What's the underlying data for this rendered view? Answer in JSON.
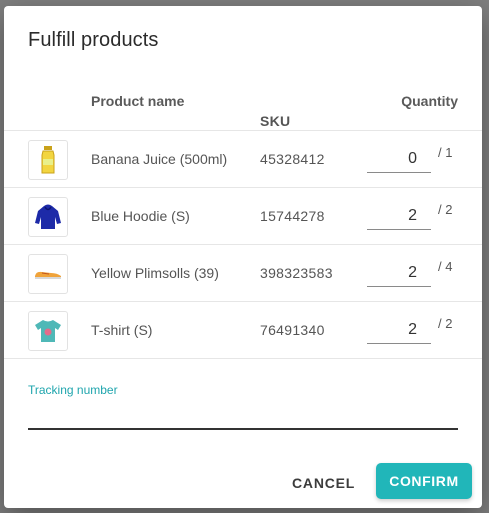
{
  "dialog": {
    "title": "Fulfill products",
    "columns": {
      "product_name": "Product name",
      "sku": "SKU",
      "quantity": "Quantity"
    },
    "rows": [
      {
        "icon": "juice-bottle-icon",
        "name": "Banana Juice (500ml)",
        "sku": "45328412",
        "quantity": "0",
        "total": "/ 1"
      },
      {
        "icon": "hoodie-icon",
        "name": "Blue Hoodie (S)",
        "sku": "15744278",
        "quantity": "2",
        "total": "/ 2"
      },
      {
        "icon": "plimsoll-shoe-icon",
        "name": "Yellow Plimsolls (39)",
        "sku": "398323583",
        "quantity": "2",
        "total": "/ 4"
      },
      {
        "icon": "tshirt-icon",
        "name": "T-shirt (S)",
        "sku": "76491340",
        "quantity": "2",
        "total": "/ 2"
      }
    ],
    "tracking": {
      "label": "Tracking number",
      "value": ""
    },
    "buttons": {
      "cancel": "CANCEL",
      "confirm": "CONFIRM"
    }
  },
  "colors": {
    "accent": "#21b6b9",
    "tracking_label": "#1fa5ad"
  }
}
